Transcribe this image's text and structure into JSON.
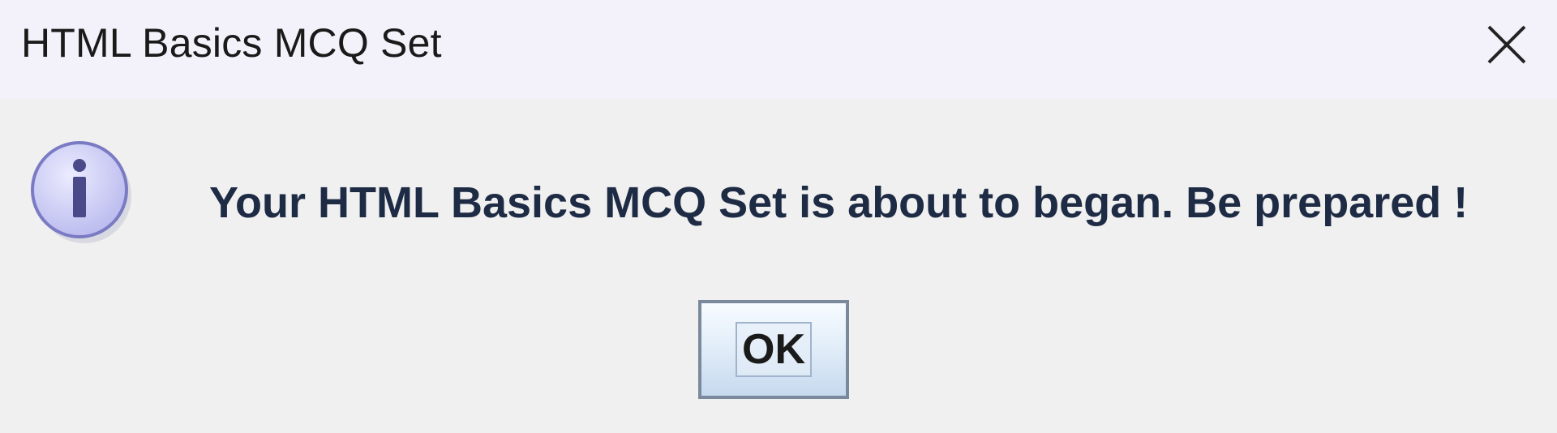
{
  "window": {
    "title": "HTML Basics MCQ Set",
    "close_icon": "close-icon"
  },
  "dialog": {
    "icon": "info-icon",
    "icon_glyph": "i",
    "icon_color": "#c8c8f4",
    "message": "Your HTML Basics MCQ Set is about to began. Be prepared !",
    "ok_label": "OK"
  }
}
